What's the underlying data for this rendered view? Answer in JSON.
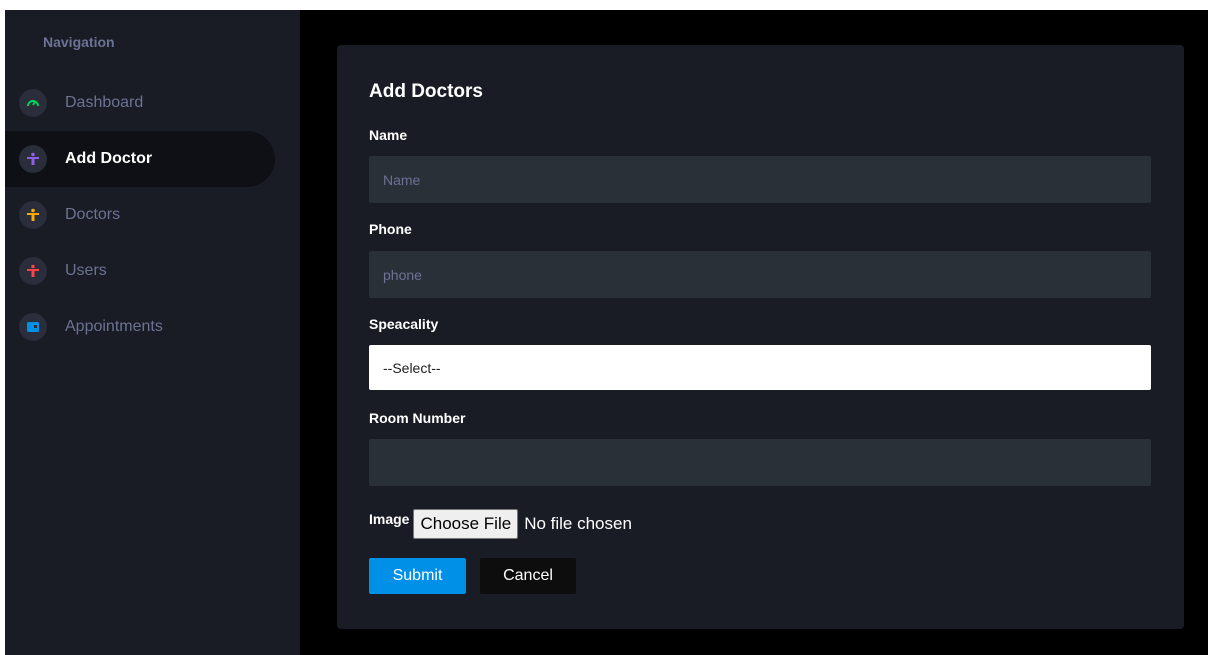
{
  "sidebar": {
    "heading": "Navigation",
    "items": [
      {
        "label": "Dashboard",
        "icon": "speedometer-icon",
        "icon_color": "#00d25b",
        "active": false
      },
      {
        "label": "Add Doctor",
        "icon": "person-icon",
        "icon_color": "#8f5fe8",
        "active": true
      },
      {
        "label": "Doctors",
        "icon": "person-icon",
        "icon_color": "#ffab00",
        "active": false
      },
      {
        "label": "Users",
        "icon": "person-icon",
        "icon_color": "#fc424a",
        "active": false
      },
      {
        "label": "Appointments",
        "icon": "calendar-icon",
        "icon_color": "#0090e7",
        "active": false
      }
    ]
  },
  "form": {
    "title": "Add Doctors",
    "name": {
      "label": "Name",
      "placeholder": "Name",
      "value": ""
    },
    "phone": {
      "label": "Phone",
      "placeholder": "phone",
      "value": ""
    },
    "speciality": {
      "label": "Speacality",
      "selected": "--Select--"
    },
    "room": {
      "label": "Room Number",
      "placeholder": "",
      "value": ""
    },
    "image": {
      "label": "Image",
      "button": "Choose File",
      "status": "No file chosen"
    },
    "submit_label": "Submit",
    "cancel_label": "Cancel"
  },
  "colors": {
    "accent": "#0090e7",
    "sidebar_bg": "#191c24",
    "page_bg": "#000000",
    "input_bg": "#2a3038"
  }
}
